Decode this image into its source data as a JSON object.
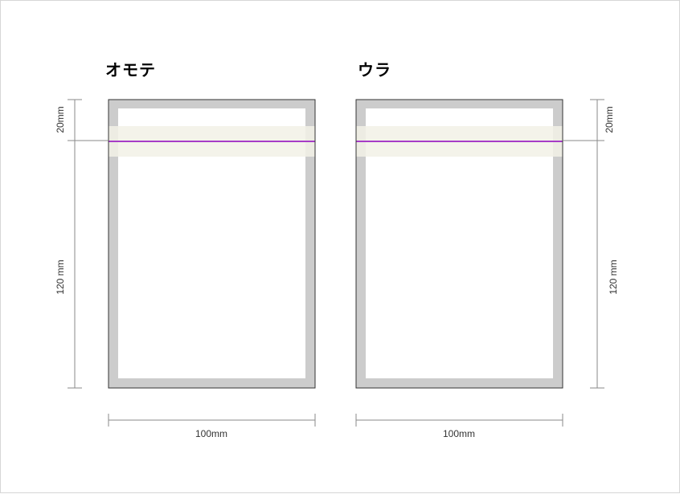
{
  "panels": {
    "front": {
      "title": "オモテ"
    },
    "back": {
      "title": "ウラ"
    }
  },
  "dimensions": {
    "top_band": "20mm",
    "height": "120 mm",
    "width_front": "100mm",
    "width_back": "100mm"
  },
  "colors": {
    "frame": "#cccccc",
    "band": "#f2f1e6",
    "fold_line": "#a63cc7",
    "outline": "#333333",
    "dim_line": "#8a8a8a"
  }
}
